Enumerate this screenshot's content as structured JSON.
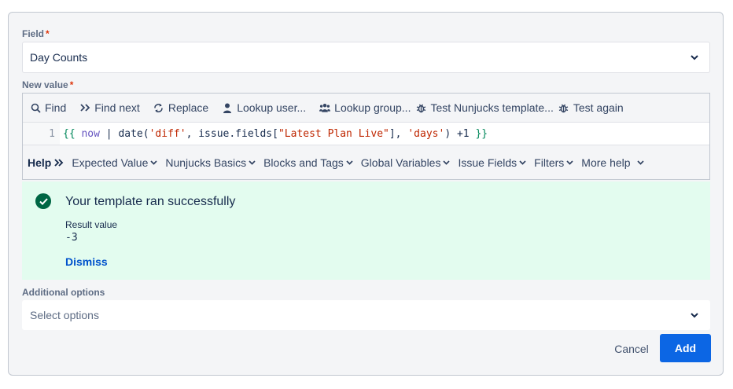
{
  "field": {
    "label": "Field",
    "required_mark": "*",
    "value": "Day Counts"
  },
  "new_value": {
    "label": "New value",
    "required_mark": "*"
  },
  "toolbar": {
    "find": "Find",
    "find_next": "Find next",
    "replace": "Replace",
    "lookup_user": "Lookup user...",
    "lookup_group": "Lookup group...",
    "test_template": "Test Nunjucks template...",
    "test_again": "Test again"
  },
  "editor": {
    "line_number": "1",
    "tokens": {
      "open": "{{",
      "now": "now",
      "pipe": " | date(",
      "diff": "'diff'",
      "mid": ", issue.fields[",
      "field_name": "\"Latest Plan Live\"",
      "mid2": "], ",
      "days": "'days'",
      "tail": ") +1 ",
      "close": "}}"
    }
  },
  "helpbar": {
    "title": "Help",
    "items": [
      "Expected Value",
      "Nunjucks Basics",
      "Blocks and Tags",
      "Global Variables",
      "Issue Fields",
      "Filters",
      "More help"
    ]
  },
  "success": {
    "title": "Your template ran successfully",
    "result_label": "Result value",
    "result_value": "-3",
    "dismiss": "Dismiss"
  },
  "additional_options": {
    "label": "Additional options",
    "placeholder": "Select options"
  },
  "actions": {
    "cancel": "Cancel",
    "add": "Add"
  },
  "colors": {
    "primary": "#0c66e4",
    "success_bg": "#e3fcef",
    "success_icon": "#006644",
    "required": "#de350b"
  }
}
